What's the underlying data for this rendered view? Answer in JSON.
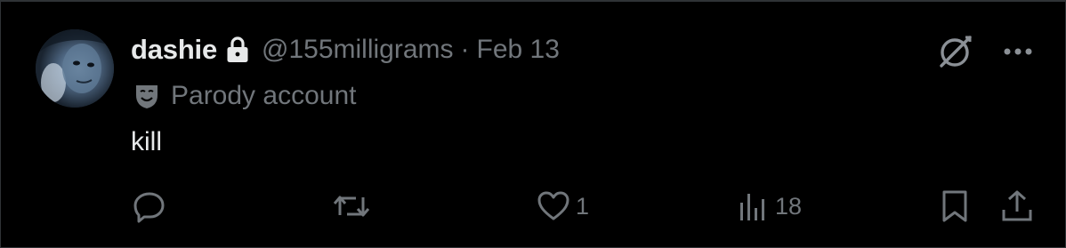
{
  "tweet": {
    "display_name": "dashie",
    "handle": "@155milligrams",
    "separator": "·",
    "date": "Feb 13",
    "label_text": "Parody account",
    "text": "kill"
  },
  "actions": {
    "reply": {
      "icon": "reply-icon",
      "count": ""
    },
    "repost": {
      "icon": "repost-icon",
      "count": ""
    },
    "like": {
      "icon": "heart-icon",
      "count": "1"
    },
    "views": {
      "icon": "bar-chart-icon",
      "count": "18"
    },
    "bookmark": {
      "icon": "bookmark-icon"
    },
    "share": {
      "icon": "share-icon"
    }
  },
  "colors": {
    "background": "#000000",
    "primary_text": "#e7e9ea",
    "secondary_text": "#71767b",
    "border": "#2f3336"
  }
}
